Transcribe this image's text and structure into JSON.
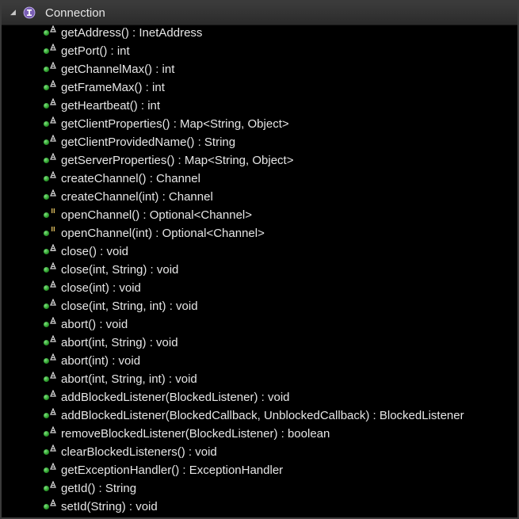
{
  "outline": {
    "title": "Connection",
    "expander_icon": "expanded-triangle-icon",
    "type_icon": "interface-icon",
    "members": [
      {
        "label": "getAddress() : InetAddress",
        "visibility_icon": "public-method-icon",
        "badge_icon": "abstract-icon"
      },
      {
        "label": "getPort() : int",
        "visibility_icon": "public-method-icon",
        "badge_icon": "abstract-icon"
      },
      {
        "label": "getChannelMax() : int",
        "visibility_icon": "public-method-icon",
        "badge_icon": "abstract-icon"
      },
      {
        "label": "getFrameMax() : int",
        "visibility_icon": "public-method-icon",
        "badge_icon": "abstract-icon"
      },
      {
        "label": "getHeartbeat() : int",
        "visibility_icon": "public-method-icon",
        "badge_icon": "abstract-icon"
      },
      {
        "label": "getClientProperties() : Map<String, Object>",
        "visibility_icon": "public-method-icon",
        "badge_icon": "abstract-icon"
      },
      {
        "label": "getClientProvidedName() : String",
        "visibility_icon": "public-method-icon",
        "badge_icon": "abstract-icon"
      },
      {
        "label": "getServerProperties() : Map<String, Object>",
        "visibility_icon": "public-method-icon",
        "badge_icon": "abstract-icon"
      },
      {
        "label": "createChannel() : Channel",
        "visibility_icon": "public-method-icon",
        "badge_icon": "abstract-icon"
      },
      {
        "label": "createChannel(int) : Channel",
        "visibility_icon": "public-method-icon",
        "badge_icon": "abstract-icon"
      },
      {
        "label": "openChannel() : Optional<Channel>",
        "visibility_icon": "public-method-icon",
        "badge_icon": "default-method-icon"
      },
      {
        "label": "openChannel(int) : Optional<Channel>",
        "visibility_icon": "public-method-icon",
        "badge_icon": "default-method-icon"
      },
      {
        "label": "close() : void",
        "visibility_icon": "public-method-icon",
        "badge_icon": "override-abstract-icon"
      },
      {
        "label": "close(int, String) : void",
        "visibility_icon": "public-method-icon",
        "badge_icon": "abstract-icon"
      },
      {
        "label": "close(int) : void",
        "visibility_icon": "public-method-icon",
        "badge_icon": "abstract-icon"
      },
      {
        "label": "close(int, String, int) : void",
        "visibility_icon": "public-method-icon",
        "badge_icon": "abstract-icon"
      },
      {
        "label": "abort() : void",
        "visibility_icon": "public-method-icon",
        "badge_icon": "abstract-icon"
      },
      {
        "label": "abort(int, String) : void",
        "visibility_icon": "public-method-icon",
        "badge_icon": "abstract-icon"
      },
      {
        "label": "abort(int) : void",
        "visibility_icon": "public-method-icon",
        "badge_icon": "abstract-icon"
      },
      {
        "label": "abort(int, String, int) : void",
        "visibility_icon": "public-method-icon",
        "badge_icon": "abstract-icon"
      },
      {
        "label": "addBlockedListener(BlockedListener) : void",
        "visibility_icon": "public-method-icon",
        "badge_icon": "abstract-icon"
      },
      {
        "label": "addBlockedListener(BlockedCallback, UnblockedCallback) : BlockedListener",
        "visibility_icon": "public-method-icon",
        "badge_icon": "abstract-icon"
      },
      {
        "label": "removeBlockedListener(BlockedListener) : boolean",
        "visibility_icon": "public-method-icon",
        "badge_icon": "abstract-icon"
      },
      {
        "label": "clearBlockedListeners() : void",
        "visibility_icon": "public-method-icon",
        "badge_icon": "abstract-icon"
      },
      {
        "label": "getExceptionHandler() : ExceptionHandler",
        "visibility_icon": "public-method-icon",
        "badge_icon": "abstract-icon"
      },
      {
        "label": "getId() : String",
        "visibility_icon": "public-method-icon",
        "badge_icon": "abstract-icon"
      },
      {
        "label": "setId(String) : void",
        "visibility_icon": "public-method-icon",
        "badge_icon": "abstract-icon"
      }
    ]
  },
  "colors": {
    "background": "#000000",
    "text": "#e6e6e6",
    "method_dot": "#2ea02e",
    "header": "#333333"
  }
}
